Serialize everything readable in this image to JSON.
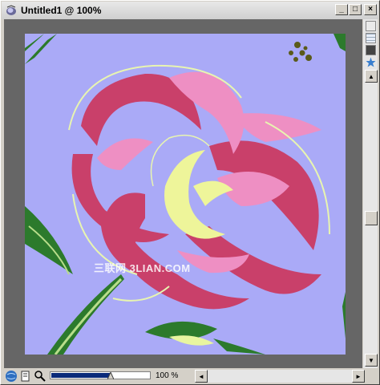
{
  "window": {
    "title": "Untitled1 @ 100%",
    "minimize_symbol": "_",
    "maximize_symbol": "□",
    "close_symbol": "×"
  },
  "canvas": {
    "background_color": "#aaaaf7",
    "surround_color": "#666666",
    "watermark": "三联网 3LIAN.COM"
  },
  "scrollbar": {
    "up_symbol": "▲",
    "down_symbol": "▼",
    "left_symbol": "◄",
    "right_symbol": "►"
  },
  "statusbar": {
    "zoom_label": "100 %",
    "zoom_level": 0.6
  },
  "icons": [
    "app-icon",
    "layers-icon",
    "grid-icon",
    "monitor-icon",
    "star-icon",
    "globe-icon",
    "zoom-icon"
  ]
}
